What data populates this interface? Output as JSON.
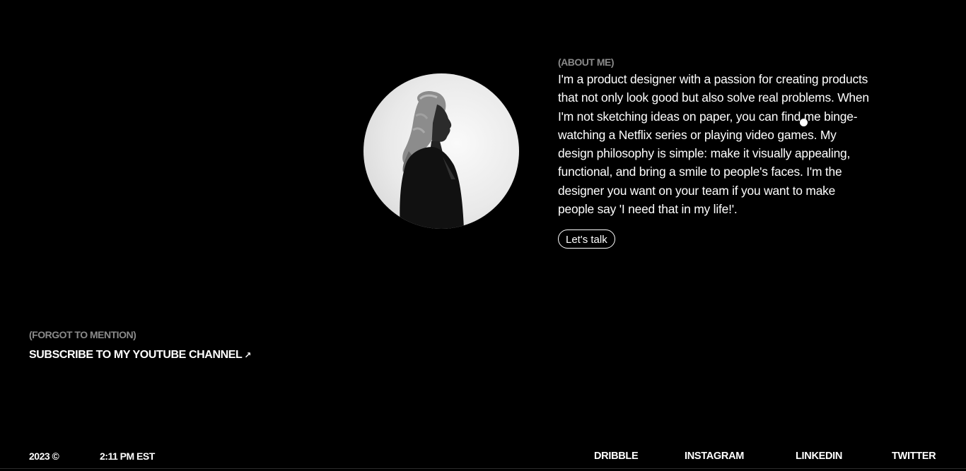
{
  "about": {
    "label": "(ABOUT ME)",
    "text": "I'm a product designer with a passion for creating products that not only look good but also solve real problems. When I'm not sketching ideas on paper, you can find me binge-watching a Netflix series or playing video games. My design philosophy is simple: make it visually appealing, functional, and bring a smile to people's faces. I'm the designer you want on your team if you want to make people say 'I need that in my life!'.",
    "button_label": "Let's talk"
  },
  "extra": {
    "label": "(FORGOT TO MENTION)",
    "link_label": "SUBSCRIBE TO MY YOUTUBE CHANNEL",
    "link_icon": "arrow-up-right-icon"
  },
  "footer": {
    "year": "2023 ©",
    "time": "2:11 PM EST",
    "social": [
      "DRIBBLE",
      "INSTAGRAM",
      "LINKEDIN",
      "TWITTER"
    ]
  },
  "colors": {
    "background": "#000000",
    "text": "#ffffff",
    "muted": "#8a8a8a"
  }
}
